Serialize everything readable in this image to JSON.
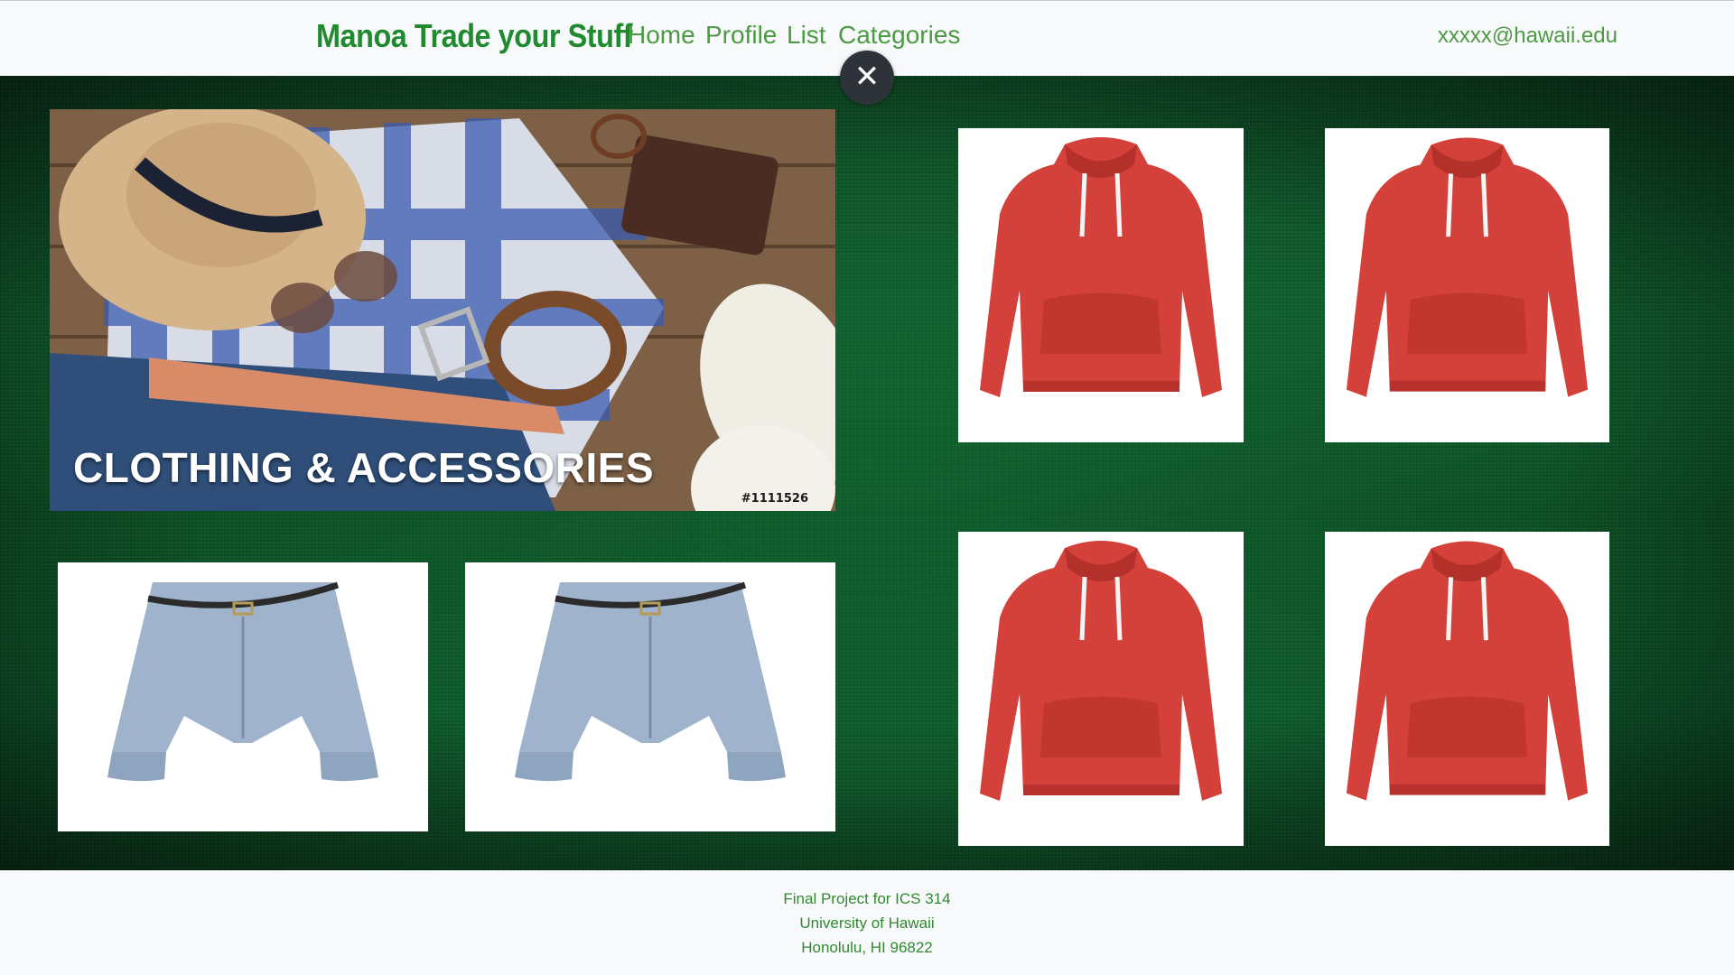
{
  "nav": {
    "brand": "Manoa Trade your Stuff",
    "links": [
      "Home",
      "Profile",
      "List",
      "Categories"
    ],
    "user_email": "xxxxx@hawaii.edu"
  },
  "overlay": {
    "close_symbol": "✕"
  },
  "featured": {
    "title": "CLOTHING & ACCESSORIES",
    "code": "#1111526"
  },
  "footer": {
    "line1": "Final Project for ICS 314",
    "line2": "University of Hawaii",
    "line3": "Honolulu, HI 96822"
  },
  "colors": {
    "brand_green": "#1f8a2e",
    "link_green": "#4d9a44",
    "hero_green": "#0e5e2d",
    "hoodie_red": "#d4403a",
    "denim_blue": "#9fb3cc"
  }
}
